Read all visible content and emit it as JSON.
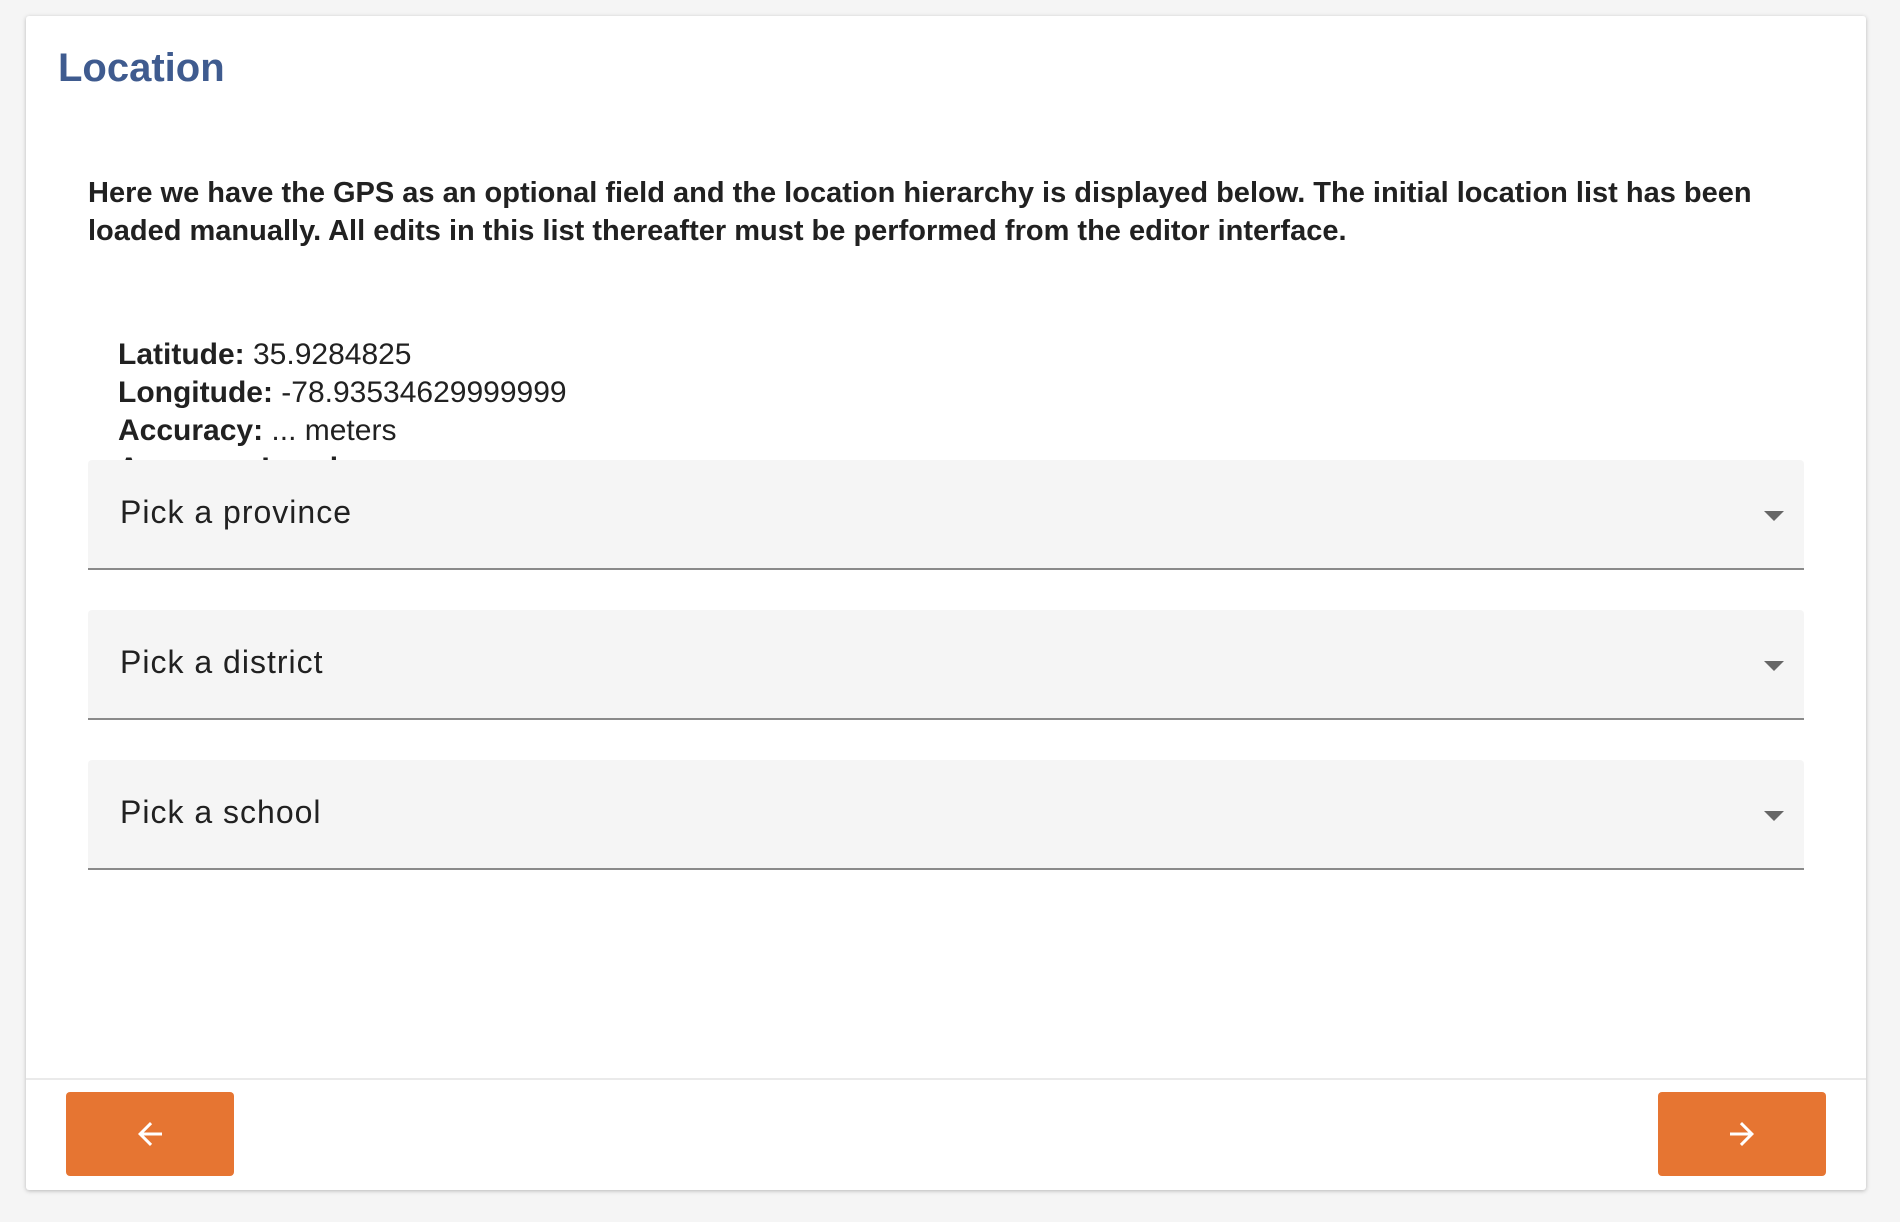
{
  "page": {
    "title": "Location",
    "intro": "Here we have the GPS as an optional field and the location hierarchy is displayed below. The initial location list has been loaded manually. All edits in this list thereafter must be performed from the editor interface."
  },
  "gps": {
    "latitude_label": "Latitude:",
    "latitude_value": "35.9284825",
    "longitude_label": "Longitude:",
    "longitude_value": "-78.93534629999999",
    "accuracy_label": "Accuracy:",
    "accuracy_value": "... meters",
    "accuracy_level_label": "Accuracy Level:",
    "accuracy_level_value": "..."
  },
  "selects": {
    "province": "Pick a province",
    "district": "Pick a district",
    "school": "Pick a school"
  },
  "navigation": {
    "prev_icon": "arrow-left-icon",
    "next_icon": "arrow-right-icon"
  },
  "colors": {
    "title": "#3f5b8f",
    "button": "#e67532",
    "select_background": "#f5f5f5"
  }
}
